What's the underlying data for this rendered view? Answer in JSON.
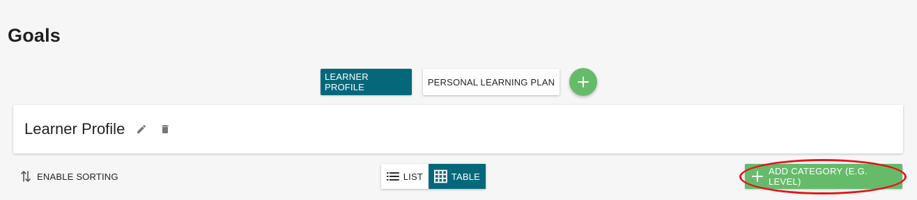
{
  "page": {
    "title": "Goals"
  },
  "tabs": [
    {
      "label": "LEARNER PROFILE",
      "active": true
    },
    {
      "label": "PERSONAL LEARNING PLAN",
      "active": false
    }
  ],
  "card": {
    "title": "Learner Profile"
  },
  "toolbar": {
    "sorting_label": "ENABLE SORTING",
    "view_list_label": "LIST",
    "view_table_label": "TABLE",
    "active_view": "table",
    "add_category_label": "ADD CATEGORY (E.G. LEVEL)"
  },
  "icons": {
    "add_tab": "plus-icon",
    "edit": "pencil-icon",
    "delete": "trash-icon",
    "sorting": "sort-arrows-icon",
    "list": "list-icon",
    "table": "grid-icon",
    "add_category": "plus-icon"
  },
  "colors": {
    "primary": "#05687a",
    "success": "#66bb6a",
    "highlight": "#e3141a",
    "background": "#f6f6f6"
  }
}
